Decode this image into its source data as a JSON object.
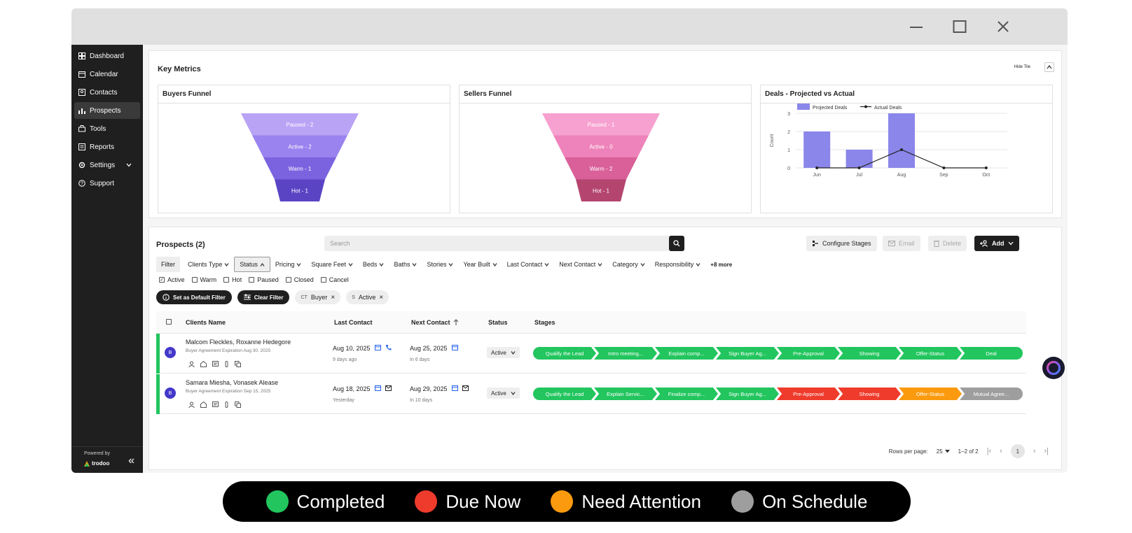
{
  "sidebar": {
    "items": [
      {
        "label": "Dashboard",
        "icon": "dashboard-icon"
      },
      {
        "label": "Calendar",
        "icon": "calendar-icon"
      },
      {
        "label": "Contacts",
        "icon": "contacts-icon"
      },
      {
        "label": "Prospects",
        "icon": "prospects-icon",
        "active": true
      },
      {
        "label": "Tools",
        "icon": "tools-icon"
      },
      {
        "label": "Reports",
        "icon": "reports-icon"
      },
      {
        "label": "Settings",
        "icon": "settings-icon"
      },
      {
        "label": "Support",
        "icon": "support-icon"
      }
    ],
    "powered_by": "Powered by",
    "brand": "trodoo"
  },
  "metrics": {
    "title": "Key Metrics",
    "hide_tile": "Hide Tile",
    "buyers_title": "Buyers Funnel",
    "sellers_title": "Sellers Funnel",
    "deals_title": "Deals - Projected vs Actual"
  },
  "buyers_funnel": [
    {
      "label": "Paused - 2",
      "color": "#b9a3f5"
    },
    {
      "label": "Active - 2",
      "color": "#9a82ef"
    },
    {
      "label": "Warm - 1",
      "color": "#7b63e0"
    },
    {
      "label": "Hot - 1",
      "color": "#5b44c4"
    }
  ],
  "sellers_funnel": [
    {
      "label": "Paused - 1",
      "color": "#f7a1d0"
    },
    {
      "label": "Active - 0",
      "color": "#ee82ba"
    },
    {
      "label": "Warm - 2",
      "color": "#d96099"
    },
    {
      "label": "Hot - 1",
      "color": "#b4456f"
    }
  ],
  "chart_data": {
    "type": "bar",
    "title": "Deals - Projected vs Actual",
    "categories": [
      "Jun",
      "Jul",
      "Aug",
      "Sep",
      "Oct"
    ],
    "series": [
      {
        "name": "Projected Deals",
        "type": "bar",
        "values": [
          2,
          1,
          3,
          0,
          0
        ],
        "color": "#8b86ea"
      },
      {
        "name": "Actual Deals",
        "type": "line",
        "values": [
          0,
          0,
          1,
          0,
          0
        ],
        "color": "#222222"
      }
    ],
    "yticks": [
      "0",
      "1",
      "2",
      "3"
    ],
    "ylabel": "Count",
    "ylim": [
      0,
      3
    ],
    "grid": true,
    "legend": "top"
  },
  "prospects": {
    "title": "Prospects (2)",
    "search_placeholder": "Search",
    "configure_stages": "Configure Stages",
    "email": "Email",
    "delete": "Delete",
    "add": "Add",
    "filters": [
      "Filter",
      "Clients Type",
      "Status",
      "Pricing",
      "Square Feet",
      "Beds",
      "Baths",
      "Stories",
      "Year Built",
      "Last Contact",
      "Next Contact",
      "Category",
      "Responsibility"
    ],
    "more": "+8 more",
    "status_options": [
      {
        "label": "Active",
        "checked": true
      },
      {
        "label": "Warm",
        "checked": false
      },
      {
        "label": "Hot",
        "checked": false
      },
      {
        "label": "Paused",
        "checked": false
      },
      {
        "label": "Closed",
        "checked": false
      },
      {
        "label": "Cancel",
        "checked": false
      }
    ],
    "set_default": "Set as Default Filter",
    "clear_filter": "Clear Filter",
    "chips": [
      {
        "prefix": "CT",
        "label": "Buyer"
      },
      {
        "prefix": "S",
        "label": "Active"
      }
    ],
    "columns": [
      "Clients Name",
      "Last Contact",
      "Next Contact",
      "Status",
      "Stages"
    ],
    "rows": [
      {
        "avatar": "B",
        "name": "Malcom Fleckles, Roxanne Hedegore",
        "sub": "Buyer Agreement Expiration Aug 30, 2025",
        "last_contact": "Aug 10, 2025",
        "last_ago": "9 days ago",
        "last_icon": "phone-icon",
        "next_contact": "Aug 25, 2025",
        "next_in": "In 6 days",
        "status": "Active",
        "stages": [
          {
            "label": "Qualify the Lead",
            "color": "#22c55e"
          },
          {
            "label": "Intro meeting...",
            "color": "#22c55e"
          },
          {
            "label": "Explain comp...",
            "color": "#22c55e"
          },
          {
            "label": "Sign Buyer Ag...",
            "color": "#22c55e"
          },
          {
            "label": "Pre-Approval",
            "color": "#22c55e"
          },
          {
            "label": "Showing",
            "color": "#22c55e"
          },
          {
            "label": "Offer-Status",
            "color": "#22c55e"
          },
          {
            "label": "Deal",
            "color": "#22c55e"
          }
        ]
      },
      {
        "avatar": "B",
        "name": "Samara Miesha, Vonasek Alease",
        "sub": "Buyer Agreement Expiration Sep 15, 2025",
        "last_contact": "Aug 18, 2025",
        "last_ago": "Yesterday",
        "last_icon": "mail-icon",
        "next_contact": "Aug 29, 2025",
        "next_in": "In 10 days",
        "status": "Active",
        "stages": [
          {
            "label": "Qualify the Lead",
            "color": "#22c55e"
          },
          {
            "label": "Explain Servic...",
            "color": "#22c55e"
          },
          {
            "label": "Finalize comp...",
            "color": "#22c55e"
          },
          {
            "label": "Sign Buyer Ag...",
            "color": "#22c55e"
          },
          {
            "label": "Pre-Approval",
            "color": "#ef3b2c"
          },
          {
            "label": "Showing",
            "color": "#ef3b2c"
          },
          {
            "label": "Offer-Status",
            "color": "#fb9a0e"
          },
          {
            "label": "Mutual Agree...",
            "color": "#9e9e9e"
          }
        ]
      }
    ],
    "rows_per_page_label": "Rows per page:",
    "rows_per_page": "25",
    "range": "1–2 of 2",
    "page": "1"
  },
  "legend": [
    {
      "label": "Completed",
      "color": "#22c55e"
    },
    {
      "label": "Due Now",
      "color": "#ef3b2c"
    },
    {
      "label": "Need Attention",
      "color": "#fb9a0e"
    },
    {
      "label": "On Schedule",
      "color": "#9e9e9e"
    }
  ]
}
